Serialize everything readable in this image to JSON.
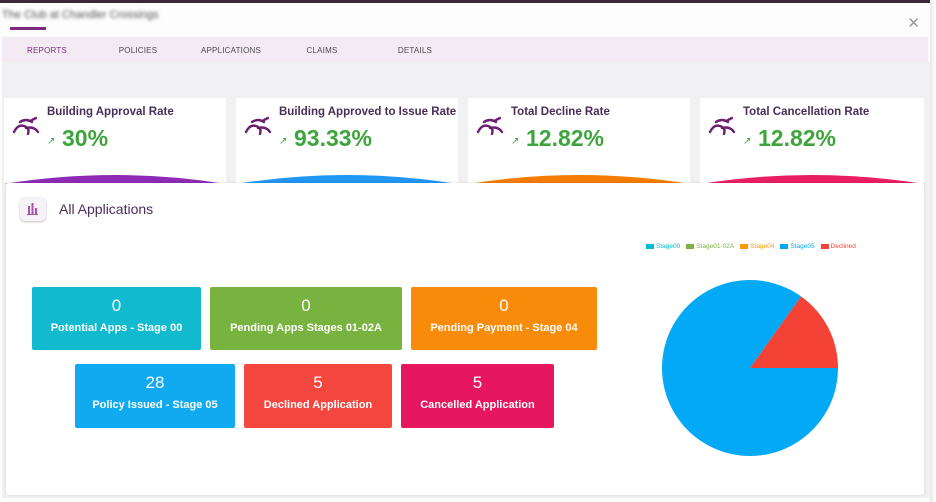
{
  "header": {
    "title": "The Club at Chandler Crossings",
    "close_icon": "close-icon"
  },
  "tabs": [
    {
      "label": "REPORTS",
      "active": true
    },
    {
      "label": "POLICIES",
      "active": false
    },
    {
      "label": "APPLICATIONS",
      "active": false
    },
    {
      "label": "CLAIMS",
      "active": false
    },
    {
      "label": "DETAILS",
      "active": false
    }
  ],
  "kpis": [
    {
      "label": "Building Approval Rate",
      "value": "30%",
      "color": "#8e2bb6",
      "icon": "runner-icon",
      "trend_icon": "trend-up-icon"
    },
    {
      "label": "Building Approved to Issue Rate",
      "value": "93.33%",
      "color": "#2196f3",
      "icon": "runner-icon",
      "trend_icon": "trend-up-icon"
    },
    {
      "label": "Total Decline Rate",
      "value": "12.82%",
      "color": "#f57c00",
      "icon": "runner-icon",
      "trend_icon": "trend-up-icon"
    },
    {
      "label": "Total Cancellation Rate",
      "value": "12.82%",
      "color": "#e91e63",
      "icon": "runner-icon",
      "trend_icon": "trend-up-icon"
    }
  ],
  "panel": {
    "title": "All Applications",
    "icon": "bar-chart-icon"
  },
  "tiles": [
    {
      "count": "0",
      "label": "Potential Apps - Stage 00",
      "color": "#12bad0"
    },
    {
      "count": "0",
      "label": "Pending Apps Stages 01-02A",
      "color": "#78b33f"
    },
    {
      "count": "0",
      "label": "Pending Payment - Stage 04",
      "color": "#f88b0a"
    },
    {
      "count": "28",
      "label": "Policy Issued - Stage 05",
      "color": "#11aaf0"
    },
    {
      "count": "5",
      "label": "Declined Application",
      "color": "#f2463e"
    },
    {
      "count": "5",
      "label": "Cancelled Application",
      "color": "#e6175e"
    }
  ],
  "chart_data": {
    "type": "pie",
    "categories": [
      "Stage00",
      "Stage01-02A",
      "Stage04",
      "Stage05",
      "Declined"
    ],
    "values": [
      0,
      0,
      0,
      28,
      5
    ],
    "colors": [
      "#00bcd4",
      "#7cb342",
      "#ff9800",
      "#03a9f4",
      "#f44336"
    ],
    "legend_position": "top"
  }
}
